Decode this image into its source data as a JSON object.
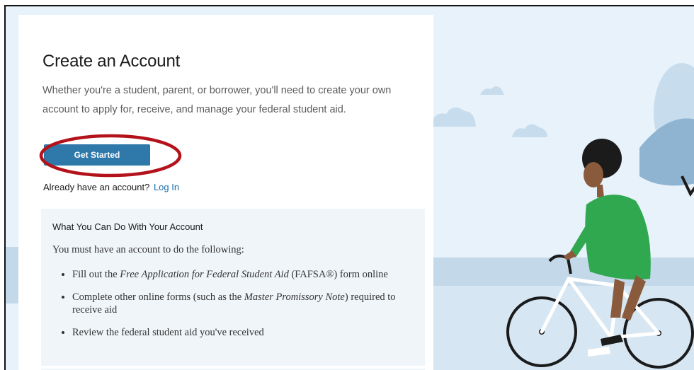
{
  "card": {
    "title": "Create an Account",
    "intro": "Whether you're a student, parent, or borrower, you'll need to create your own account to apply for, receive, and manage your federal student aid.",
    "get_started_label": "Get Started",
    "already_text": "Already have an account?",
    "login_label": "Log In"
  },
  "info": {
    "title": "What You Can Do With Your Account",
    "lead": "You must have an account to do the following:",
    "items": {
      "0": {
        "pre": "Fill out the ",
        "em": "Free Application for Federal Student Aid",
        "post": " (FAFSA®) form online"
      },
      "1": {
        "pre": "Complete other online forms (such as the ",
        "em": "Master Promissory Note",
        "post": ") required to receive aid"
      },
      "2": {
        "pre": "Review the federal student aid you've received",
        "em": "",
        "post": ""
      }
    }
  },
  "colors": {
    "button": "#2e78aa",
    "highlight_circle": "#b3121b",
    "link": "#1a6fad",
    "illustration_bg": "#e8f2fa",
    "tree": "#8fb4d1",
    "dress": "#2fa84f",
    "skin": "#8a5a3c"
  }
}
